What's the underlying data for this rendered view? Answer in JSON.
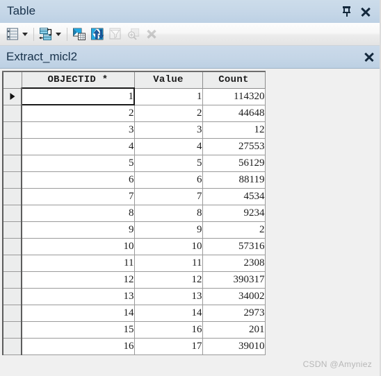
{
  "window": {
    "title": "Table",
    "buttons": [
      {
        "name": "auto-hide-pin",
        "icon": "pin-icon",
        "label": ""
      },
      {
        "name": "close-window",
        "icon": "close-icon",
        "label": ""
      }
    ]
  },
  "toolbar": {
    "items": [
      {
        "name": "table-options-button",
        "icon": "table-options-icon",
        "enabled": true,
        "has_dropdown": true
      },
      {
        "name": "related-tables-button",
        "icon": "related-tables-icon",
        "enabled": true,
        "has_dropdown": true
      },
      {
        "name": "select-by-attributes-button",
        "icon": "select-by-attributes-icon",
        "enabled": true,
        "has_dropdown": false
      },
      {
        "name": "switch-selection-button",
        "icon": "switch-selection-icon",
        "enabled": true,
        "has_dropdown": false
      },
      {
        "name": "clear-selection-button",
        "icon": "clear-selection-icon",
        "enabled": false,
        "has_dropdown": false
      },
      {
        "name": "zoom-to-selected-button",
        "icon": "zoom-to-selected-icon",
        "enabled": false,
        "has_dropdown": false
      },
      {
        "name": "delete-selected-button",
        "icon": "delete-x-icon",
        "enabled": false,
        "has_dropdown": false
      }
    ]
  },
  "tab": {
    "title": "Extract_micl2",
    "close_label": ""
  },
  "table": {
    "columns": [
      "",
      "OBJECTID *",
      "Value",
      "Count"
    ],
    "selected_row_index": 0,
    "rows": [
      {
        "objectid": "1",
        "value": "1",
        "count": "114320"
      },
      {
        "objectid": "2",
        "value": "2",
        "count": "44648"
      },
      {
        "objectid": "3",
        "value": "3",
        "count": "12"
      },
      {
        "objectid": "4",
        "value": "4",
        "count": "27553"
      },
      {
        "objectid": "5",
        "value": "5",
        "count": "56129"
      },
      {
        "objectid": "6",
        "value": "6",
        "count": "88119"
      },
      {
        "objectid": "7",
        "value": "7",
        "count": "4534"
      },
      {
        "objectid": "8",
        "value": "8",
        "count": "9234"
      },
      {
        "objectid": "9",
        "value": "9",
        "count": "2"
      },
      {
        "objectid": "10",
        "value": "10",
        "count": "57316"
      },
      {
        "objectid": "11",
        "value": "11",
        "count": "2308"
      },
      {
        "objectid": "12",
        "value": "12",
        "count": "390317"
      },
      {
        "objectid": "13",
        "value": "13",
        "count": "34002"
      },
      {
        "objectid": "14",
        "value": "14",
        "count": "2973"
      },
      {
        "objectid": "15",
        "value": "16",
        "count": "201"
      },
      {
        "objectid": "16",
        "value": "17",
        "count": "39010"
      }
    ]
  },
  "watermark": {
    "text": "CSDN @Amyniez"
  },
  "colors": {
    "titlebar": "#c6d7e8",
    "tabbar": "#c5d6e7",
    "toolbar": "#f2f2f2",
    "grid_background": "#f0f0f0",
    "header_cell": "#eceded",
    "text": "#17314a",
    "icon_blue": "#2a9fd6"
  }
}
